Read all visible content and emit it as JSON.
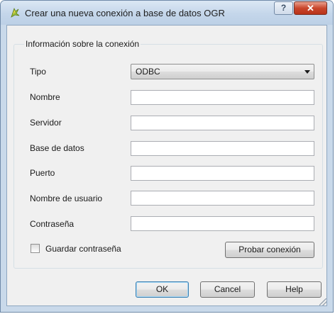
{
  "window": {
    "title": "Crear una nueva conexión a base de datos OGR",
    "help_button": "?",
    "close_button": "✕"
  },
  "group": {
    "label": "Información sobre la conexión"
  },
  "form": {
    "tipo_label": "Tipo",
    "tipo_value": "ODBC",
    "nombre_label": "Nombre",
    "nombre_value": "",
    "servidor_label": "Servidor",
    "servidor_value": "",
    "base_label": "Base de datos",
    "base_value": "",
    "puerto_label": "Puerto",
    "puerto_value": "",
    "usuario_label": "Nombre de usuario",
    "usuario_value": "",
    "contrasena_label": "Contraseña",
    "contrasena_value": "",
    "guardar_label": "Guardar contraseña",
    "probar_button": "Probar conexión"
  },
  "buttons": {
    "ok": "OK",
    "cancel": "Cancel",
    "help": "Help"
  },
  "colors": {
    "titlebar": "#c4d6ea",
    "close_button": "#c9462c",
    "dialog_bg": "#f0f0f0"
  }
}
